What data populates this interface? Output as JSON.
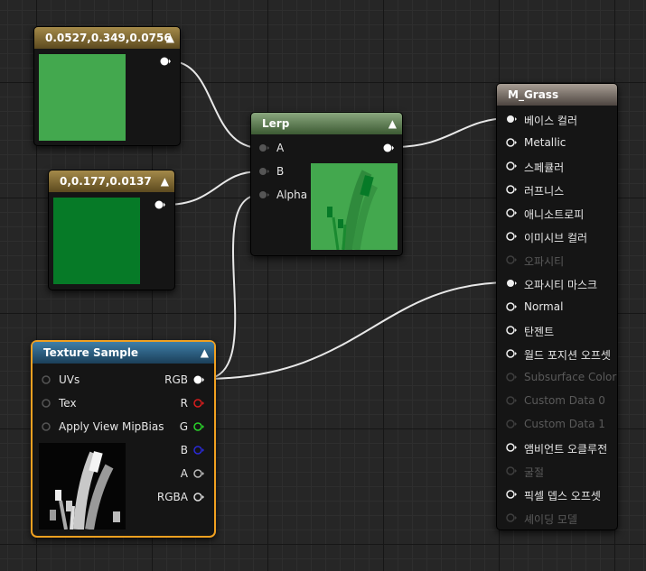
{
  "colors": {
    "const1_swatch": "#43a84e",
    "const2_swatch": "#067a27",
    "wire": "#e8e8e8",
    "pin_red": "#d81d1d",
    "pin_green": "#2ad42a",
    "pin_blue": "#2a2ad8",
    "selection": "#f0a020"
  },
  "const1": {
    "title": "0.0527,0.349,0.0756"
  },
  "const2": {
    "title": "0,0.177,0.0137"
  },
  "lerp": {
    "title": "Lerp",
    "inputs": [
      "A",
      "B",
      "Alpha"
    ]
  },
  "texture": {
    "title": "Texture Sample",
    "inputs": [
      "UVs",
      "Tex",
      "Apply View MipBias"
    ],
    "outputs": [
      "RGB",
      "R",
      "G",
      "B",
      "A",
      "RGBA"
    ]
  },
  "material": {
    "title": "M_Grass",
    "pins": [
      {
        "label": "베이스 컬러",
        "enabled": true,
        "connected": true
      },
      {
        "label": "Metallic",
        "enabled": true,
        "connected": false
      },
      {
        "label": "스페큘러",
        "enabled": true,
        "connected": false
      },
      {
        "label": "러프니스",
        "enabled": true,
        "connected": false
      },
      {
        "label": "애니소트로피",
        "enabled": true,
        "connected": false
      },
      {
        "label": "이미시브 컬러",
        "enabled": true,
        "connected": false
      },
      {
        "label": "오파시티",
        "enabled": false,
        "connected": false
      },
      {
        "label": "오파시티 마스크",
        "enabled": true,
        "connected": true
      },
      {
        "label": "Normal",
        "enabled": true,
        "connected": false
      },
      {
        "label": "탄젠트",
        "enabled": true,
        "connected": false
      },
      {
        "label": "월드 포지션 오프셋",
        "enabled": true,
        "connected": false
      },
      {
        "label": "Subsurface Color",
        "enabled": false,
        "connected": false
      },
      {
        "label": "Custom Data 0",
        "enabled": false,
        "connected": false
      },
      {
        "label": "Custom Data 1",
        "enabled": false,
        "connected": false
      },
      {
        "label": "앰비언트 오클루전",
        "enabled": true,
        "connected": false
      },
      {
        "label": "굴절",
        "enabled": false,
        "connected": false
      },
      {
        "label": "픽셀 뎁스 오프셋",
        "enabled": true,
        "connected": false
      },
      {
        "label": "셰이딩 모델",
        "enabled": false,
        "connected": false
      }
    ]
  }
}
